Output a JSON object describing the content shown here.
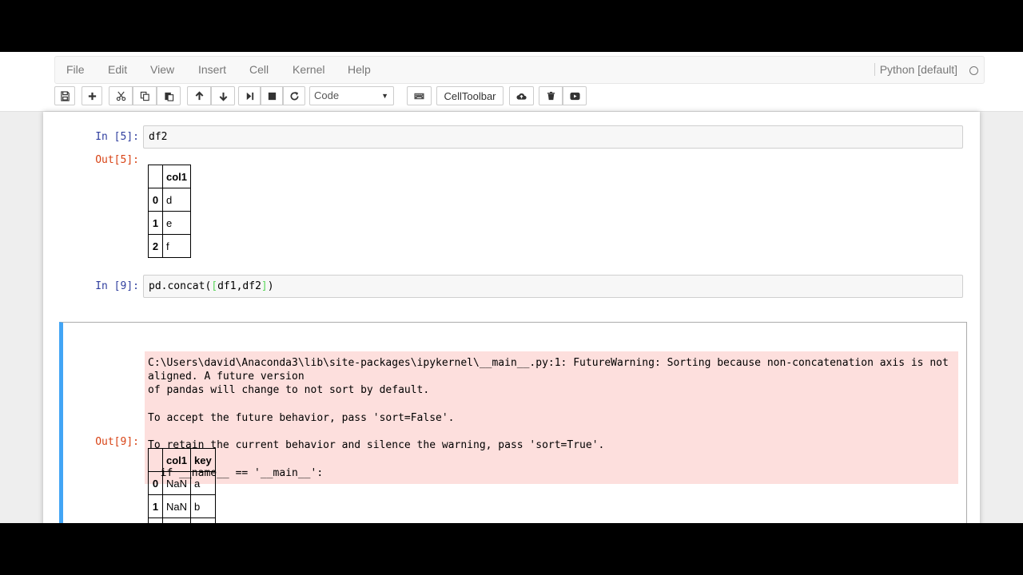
{
  "menu": {
    "items": [
      "File",
      "Edit",
      "View",
      "Insert",
      "Cell",
      "Kernel",
      "Help"
    ],
    "kernel_name": "Python [default]"
  },
  "toolbar": {
    "cell_type": "Code",
    "celltoolbar_label": "CellToolbar",
    "icons": [
      "save-icon",
      "plus-icon",
      "cut-icon",
      "copy-icon",
      "paste-icon",
      "arrow-up-icon",
      "arrow-down-icon",
      "step-forward-icon",
      "stop-icon",
      "restart-icon",
      "keyboard-icon",
      "cloud-upload-icon",
      "trash-icon",
      "play-icon"
    ]
  },
  "cells": {
    "cell1": {
      "in_prompt": "In [5]:",
      "code": "df2",
      "out_prompt": "Out[5]:",
      "table": {
        "header": [
          "",
          "col1"
        ],
        "rows": [
          [
            "0",
            "d"
          ],
          [
            "1",
            "e"
          ],
          [
            "2",
            "f"
          ]
        ]
      }
    },
    "cell2": {
      "in_prompt": "In [9]:",
      "code_prefix": "pd.concat(",
      "code_open": "[",
      "code_middle": "df1,df2",
      "code_close": "]",
      "code_suffix": ")",
      "stderr": "C:\\Users\\david\\Anaconda3\\lib\\site-packages\\ipykernel\\__main__.py:1: FutureWarning: Sorting because non-concatenation axis is not aligned. A future version\nof pandas will change to not sort by default.\n\nTo accept the future behavior, pass 'sort=False'.\n\nTo retain the current behavior and silence the warning, pass 'sort=True'.\n\n  if __name__ == '__main__':",
      "out_prompt": "Out[9]:",
      "table": {
        "header": [
          "",
          "col1",
          "key"
        ],
        "rows": [
          [
            "0",
            "NaN",
            "a"
          ],
          [
            "1",
            "NaN",
            "b"
          ]
        ]
      }
    }
  },
  "colors": {
    "in_prompt": "#303f9f",
    "out_prompt": "#d84315",
    "selected_border": "#42a5f5",
    "stderr_bg": "#fddfdd"
  }
}
